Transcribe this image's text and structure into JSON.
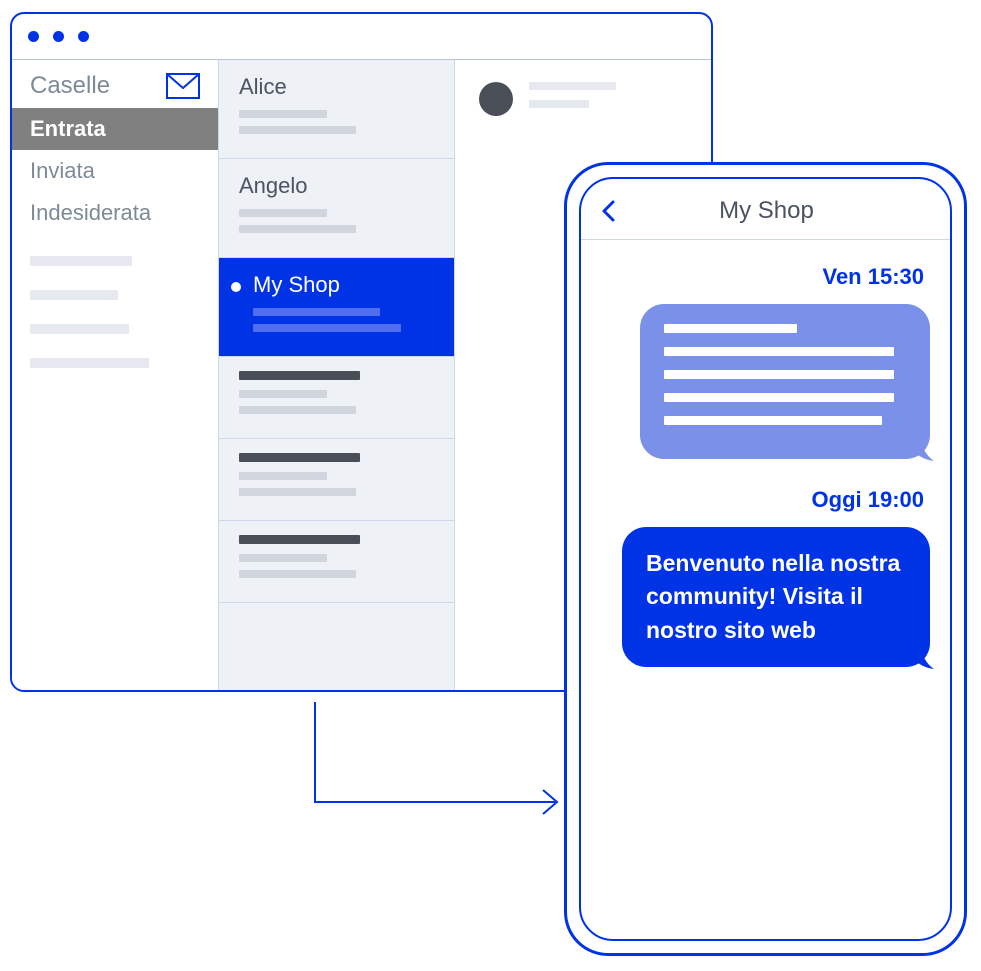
{
  "email": {
    "sidebar": {
      "title": "Caselle",
      "folders": [
        "Entrata",
        "Inviata",
        "Indesiderata"
      ],
      "active_index": 0
    },
    "messages": [
      {
        "name": "Alice",
        "selected": false
      },
      {
        "name": "Angelo",
        "selected": false
      },
      {
        "name": "My Shop",
        "selected": true
      },
      {
        "name": "",
        "selected": false
      },
      {
        "name": "",
        "selected": false
      },
      {
        "name": "",
        "selected": false
      }
    ]
  },
  "phone": {
    "title": "My Shop",
    "chat": {
      "ts1": "Ven 15:30",
      "ts2": "Oggi 19:00",
      "message": "Benvenuto nella nostra community! Visita il nostro sito web"
    }
  },
  "colors": {
    "brand": "#0033e6",
    "bubble_light": "#7b90e8"
  }
}
